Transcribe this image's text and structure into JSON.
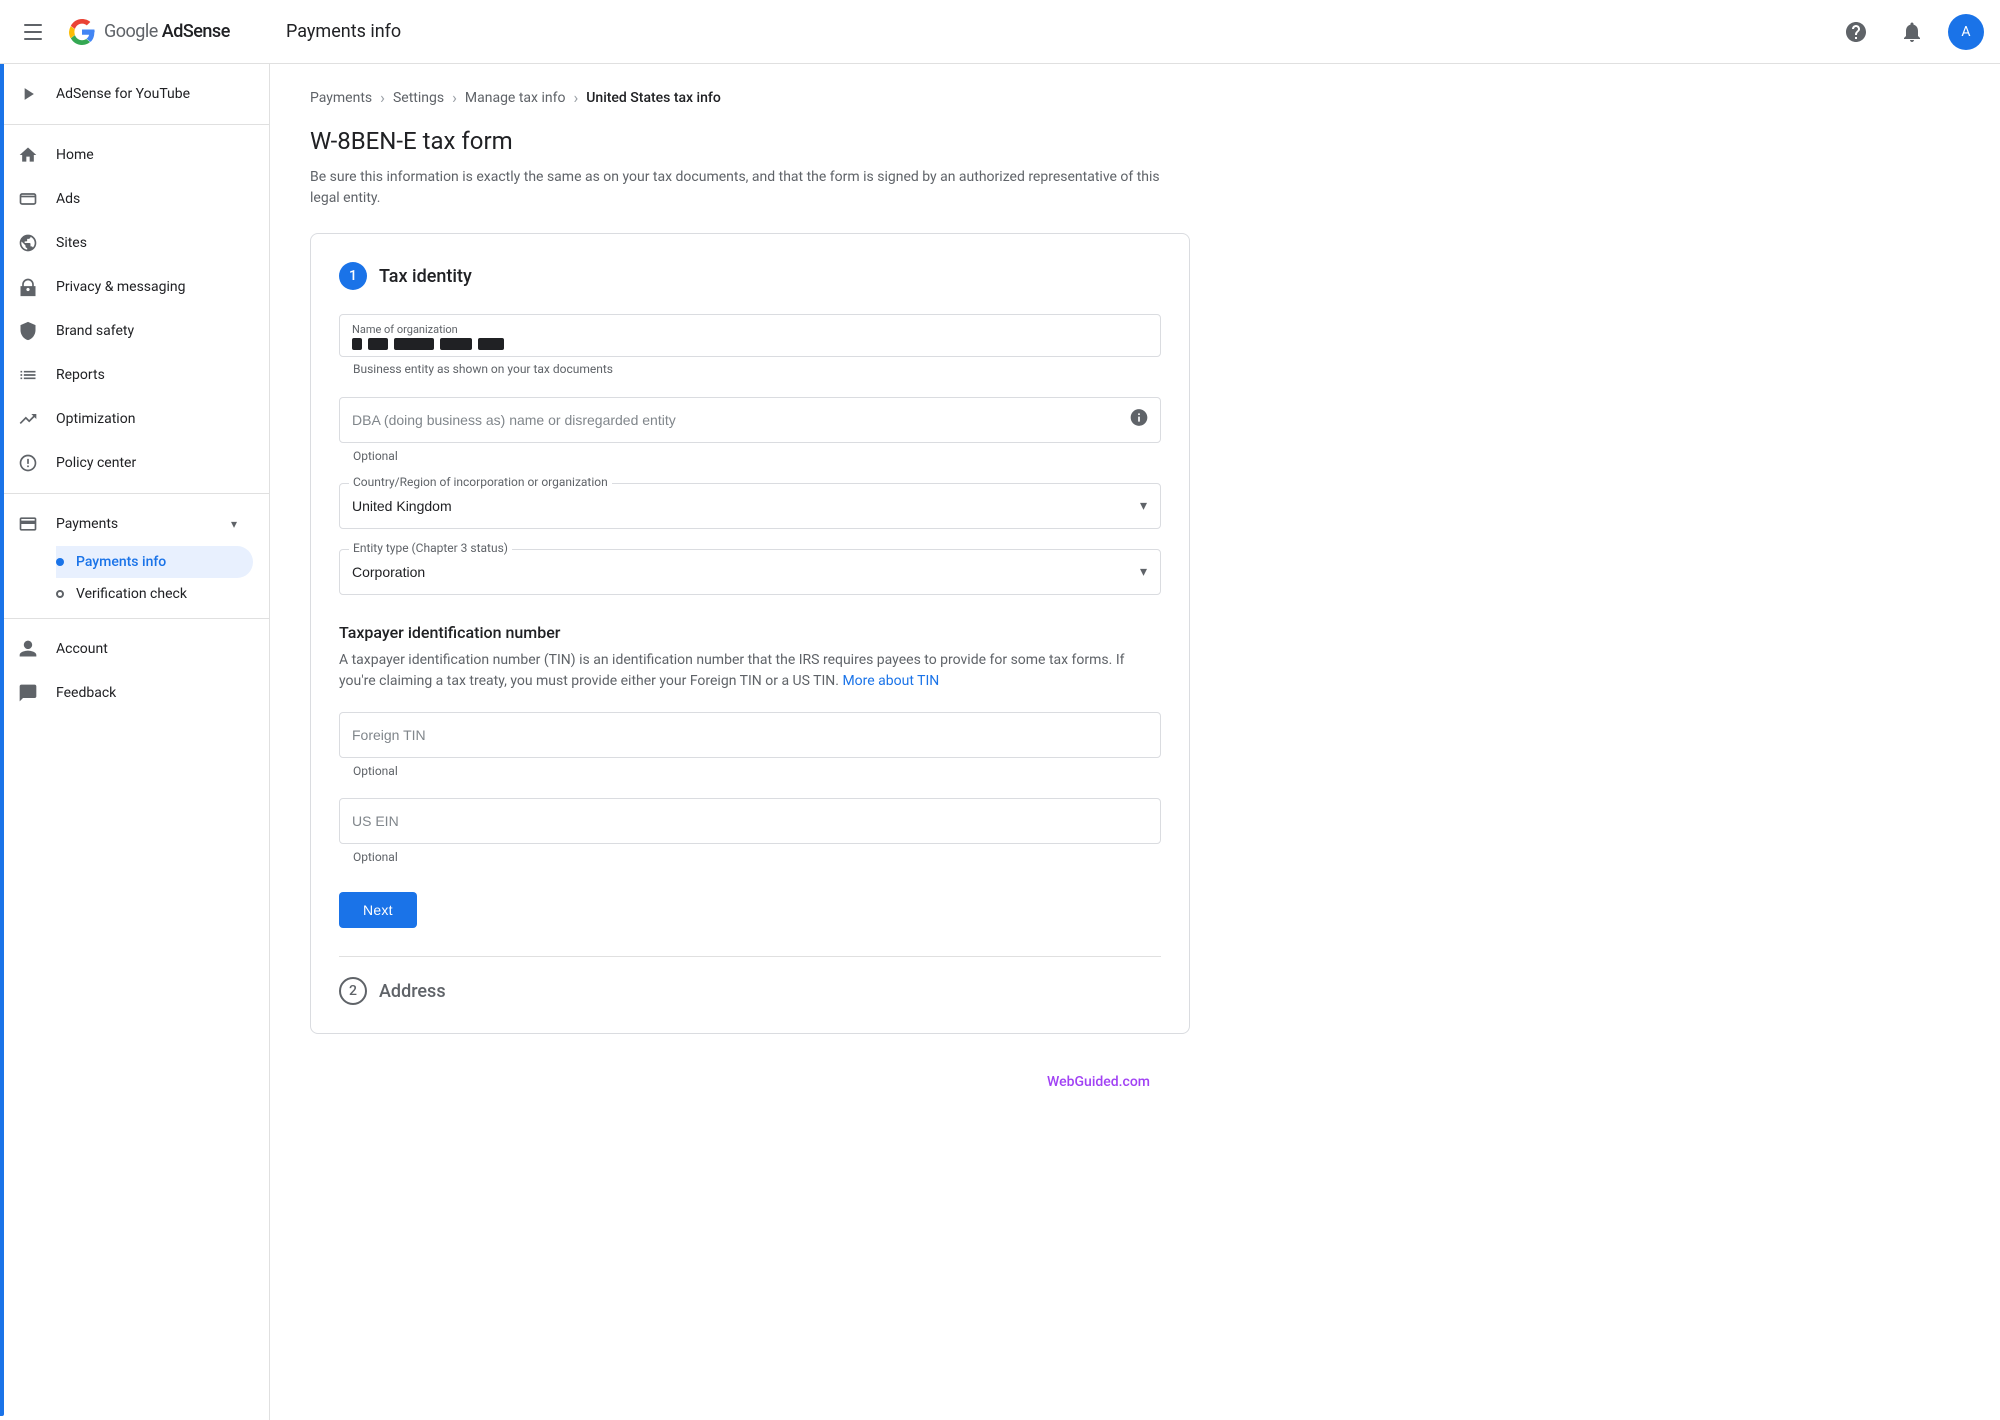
{
  "topbar": {
    "title": "Payments info",
    "logo_name": "Google AdSense"
  },
  "breadcrumb": {
    "items": [
      "Payments",
      "Settings",
      "Manage tax info"
    ],
    "current": "United States tax info"
  },
  "page": {
    "title": "W-8BEN-E tax form",
    "description": "Be sure this information is exactly the same as on your tax documents, and that the form is signed by an authorized representative of this legal entity."
  },
  "section1": {
    "number": "1",
    "title": "Tax identity",
    "org_name_label": "Name of organization",
    "org_name_helper": "Business entity as shown on your tax documents",
    "dba_placeholder": "DBA (doing business as) name or disregarded entity",
    "dba_helper": "Optional",
    "country_label": "Country/Region of incorporation or organization",
    "country_value": "United Kingdom",
    "entity_label": "Entity type (Chapter 3 status)",
    "entity_value": "Corporation",
    "tin_title": "Taxpayer identification number",
    "tin_desc": "A taxpayer identification number (TIN) is an identification number that the IRS requires payees to provide for some tax forms. If you're claiming a tax treaty, you must provide either your Foreign TIN or a US TIN.",
    "tin_link_text": "More about TIN",
    "foreign_tin_placeholder": "Foreign TIN",
    "foreign_tin_helper": "Optional",
    "us_ein_placeholder": "US EIN",
    "us_ein_helper": "Optional",
    "next_label": "Next"
  },
  "section2": {
    "number": "2",
    "title": "Address"
  },
  "sidebar": {
    "adsense_label": "AdSense for YouTube",
    "items": [
      {
        "id": "home",
        "label": "Home",
        "icon": "home"
      },
      {
        "id": "ads",
        "label": "Ads",
        "icon": "ads"
      },
      {
        "id": "sites",
        "label": "Sites",
        "icon": "sites"
      },
      {
        "id": "privacy-messaging",
        "label": "Privacy & messaging",
        "icon": "privacy"
      },
      {
        "id": "brand-safety",
        "label": "Brand safety",
        "icon": "brand"
      },
      {
        "id": "reports",
        "label": "Reports",
        "icon": "reports"
      },
      {
        "id": "optimization",
        "label": "Optimization",
        "icon": "optimization"
      },
      {
        "id": "policy-center",
        "label": "Policy center",
        "icon": "policy"
      },
      {
        "id": "payments",
        "label": "Payments",
        "icon": "payments",
        "expanded": true
      },
      {
        "id": "account",
        "label": "Account",
        "icon": "account"
      },
      {
        "id": "feedback",
        "label": "Feedback",
        "icon": "feedback"
      }
    ],
    "payments_sub": [
      {
        "id": "payments-info",
        "label": "Payments info",
        "active": true
      },
      {
        "id": "verification-check",
        "label": "Verification check",
        "active": false
      }
    ]
  },
  "watermark": "WebGuided.com"
}
